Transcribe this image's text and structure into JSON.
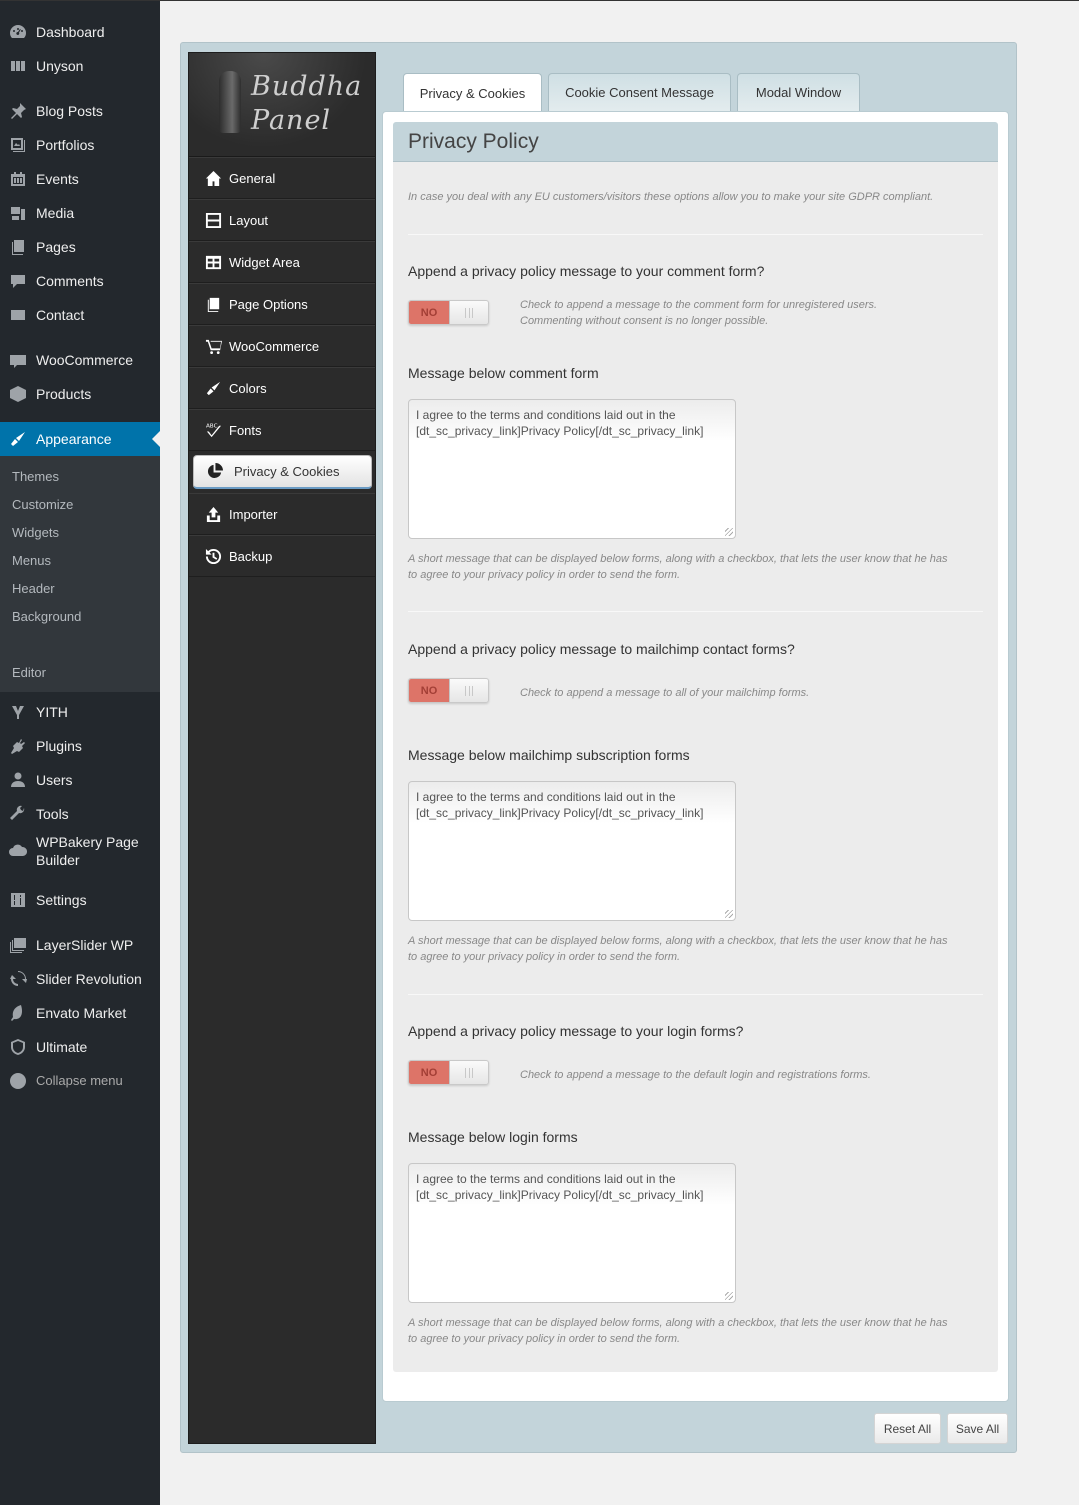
{
  "wp_menu": {
    "items": [
      {
        "label": "Dashboard",
        "icon": "dashboard-icon"
      },
      {
        "label": "Unyson",
        "icon": "unyson-icon"
      },
      {
        "label": "Blog Posts",
        "icon": "pin-icon"
      },
      {
        "label": "Portfolios",
        "icon": "portfolio-icon"
      },
      {
        "label": "Events",
        "icon": "calendar-icon"
      },
      {
        "label": "Media",
        "icon": "media-icon"
      },
      {
        "label": "Pages",
        "icon": "pages-icon"
      },
      {
        "label": "Comments",
        "icon": "comment-icon"
      },
      {
        "label": "Contact",
        "icon": "envelope-icon"
      },
      {
        "label": "WooCommerce",
        "icon": "woo-icon"
      },
      {
        "label": "Products",
        "icon": "box-icon"
      },
      {
        "label": "Appearance",
        "icon": "paintbrush-icon"
      },
      {
        "label": "YITH",
        "icon": "yith-icon"
      },
      {
        "label": "Plugins",
        "icon": "plugin-icon"
      },
      {
        "label": "Users",
        "icon": "user-icon"
      },
      {
        "label": "Tools",
        "icon": "wrench-icon"
      },
      {
        "label": "WPBakery Page Builder",
        "icon": "cloud-icon"
      },
      {
        "label": "Settings",
        "icon": "settings-icon"
      },
      {
        "label": "LayerSlider WP",
        "icon": "layers-icon"
      },
      {
        "label": "Slider Revolution",
        "icon": "refresh-icon"
      },
      {
        "label": "Envato Market",
        "icon": "leaf-icon"
      },
      {
        "label": "Ultimate",
        "icon": "shield-icon"
      },
      {
        "label": "Collapse menu",
        "icon": "collapse-icon"
      }
    ],
    "active": "Appearance",
    "submenu": [
      "Themes",
      "Customize",
      "Widgets",
      "Menus",
      "Header",
      "Background",
      "Editor"
    ]
  },
  "panel": {
    "logo_line1": "Buddha",
    "logo_line2": "Panel",
    "nav": [
      {
        "label": "General",
        "icon": "home-icon"
      },
      {
        "label": "Layout",
        "icon": "layout-icon"
      },
      {
        "label": "Widget Area",
        "icon": "widget-icon"
      },
      {
        "label": "Page Options",
        "icon": "pages-icon"
      },
      {
        "label": "WooCommerce",
        "icon": "cart-icon"
      },
      {
        "label": "Colors",
        "icon": "paintbrush-icon"
      },
      {
        "label": "Fonts",
        "icon": "spellcheck-icon"
      },
      {
        "label": "Privacy & Cookies",
        "icon": "pie-chart-icon"
      },
      {
        "label": "Importer",
        "icon": "upload-icon"
      },
      {
        "label": "Backup",
        "icon": "history-icon"
      }
    ],
    "active_nav": "Privacy & Cookies",
    "tabs": [
      "Privacy & Cookies",
      "Cookie Consent Message",
      "Modal Window"
    ],
    "active_tab": "Privacy & Cookies",
    "section_title": "Privacy Policy",
    "intro": "In case you deal with any EU customers/visitors these options allow you to make your site GDPR compliant.",
    "options": [
      {
        "question": "Append a privacy policy message to your comment form?",
        "toggle": "NO",
        "toggle_help": [
          "Check to append a message to the comment form for unregistered users.",
          "Commenting without consent is no longer possible."
        ],
        "message_label": "Message below comment form",
        "message_value": "I agree to the terms and conditions laid out in the [dt_sc_privacy_link]Privacy Policy[/dt_sc_privacy_link]",
        "message_help": [
          "A short message that can be displayed below forms, along with a checkbox, that lets the user know that he has",
          "to agree to your privacy policy in order to send the form."
        ]
      },
      {
        "question": "Append a privacy policy message to mailchimp contact forms?",
        "toggle": "NO",
        "toggle_help": [
          "Check to append a message to all of your mailchimp forms."
        ],
        "message_label": "Message below mailchimp subscription forms",
        "message_value": "I agree to the terms and conditions laid out in the [dt_sc_privacy_link]Privacy Policy[/dt_sc_privacy_link]",
        "message_help": [
          "A short message that can be displayed below forms, along with a checkbox, that lets the user know that he has",
          "to agree to your privacy policy in order to send the form."
        ]
      },
      {
        "question": "Append a privacy policy message to your login forms?",
        "toggle": "NO",
        "toggle_help": [
          "Check to append a message to the default login and registrations forms."
        ],
        "message_label": "Message below login forms",
        "message_value": "I agree to the terms and conditions laid out in the [dt_sc_privacy_link]Privacy Policy[/dt_sc_privacy_link]",
        "message_help": [
          "A short message that can be displayed below forms, along with a checkbox, that lets the user know that he has",
          "to agree to your privacy policy in order to send the form."
        ]
      }
    ],
    "reset_label": "Reset All",
    "save_label": "Save All"
  },
  "colors": {
    "wp_sidebar": "#23282d",
    "wp_active": "#0073aa",
    "toggle_off": "#dd7468",
    "panel_bg": "#c3d4da"
  }
}
